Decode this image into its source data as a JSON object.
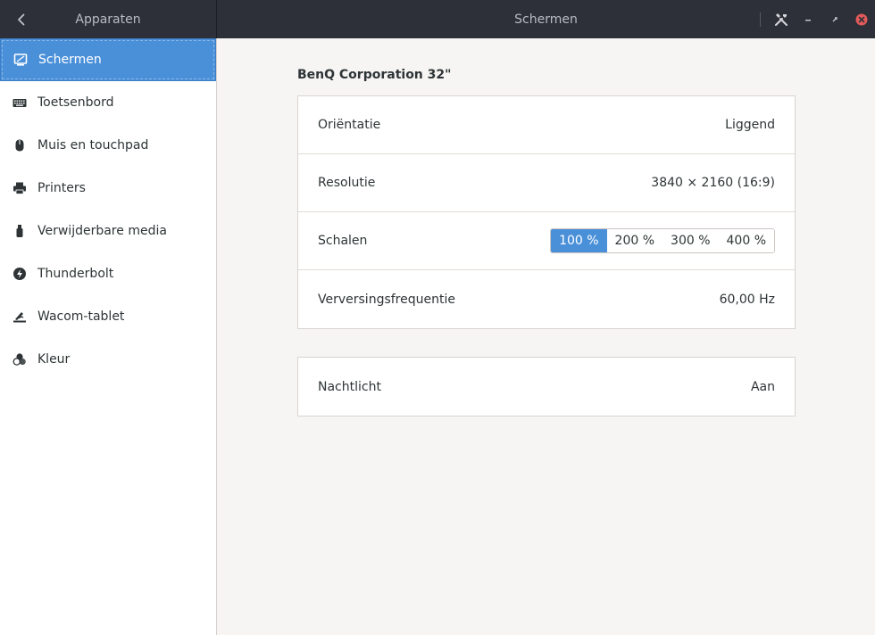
{
  "header": {
    "left_title": "Apparaten",
    "title": "Schermen"
  },
  "sidebar": {
    "items": [
      {
        "label": "Schermen",
        "icon": "display-icon",
        "active": true
      },
      {
        "label": "Toetsenbord",
        "icon": "keyboard-icon"
      },
      {
        "label": "Muis en touchpad",
        "icon": "mouse-icon"
      },
      {
        "label": "Printers",
        "icon": "printer-icon"
      },
      {
        "label": "Verwijderbare media",
        "icon": "usb-drive-icon"
      },
      {
        "label": "Thunderbolt",
        "icon": "thunderbolt-icon"
      },
      {
        "label": "Wacom-tablet",
        "icon": "tablet-icon"
      },
      {
        "label": "Kleur",
        "icon": "color-icon"
      }
    ]
  },
  "main": {
    "monitor_title": "BenQ Corporation 32\"",
    "orientation": {
      "label": "Oriëntatie",
      "value": "Liggend"
    },
    "resolution": {
      "label": "Resolutie",
      "value": "3840 × 2160 (16:9)"
    },
    "scale": {
      "label": "Schalen",
      "options": [
        "100 %",
        "200 %",
        "300 %",
        "400 %"
      ],
      "selected": "100 %"
    },
    "refresh": {
      "label": "Verversingsfrequentie",
      "value": "60,00 Hz"
    },
    "nightlight": {
      "label": "Nachtlicht",
      "value": "Aan"
    }
  },
  "colors": {
    "accent": "#4a90d9",
    "headerbar": "#2d3038",
    "close": "#e35a5a"
  }
}
